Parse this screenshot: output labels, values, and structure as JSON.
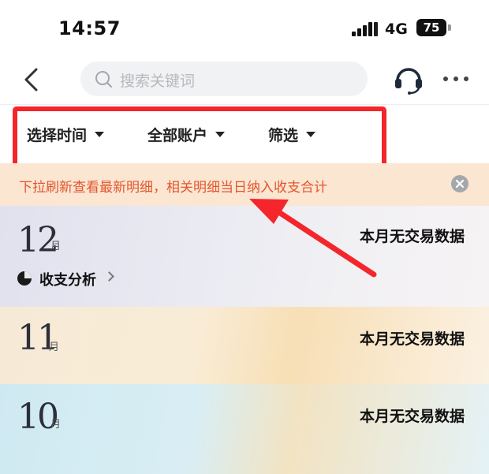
{
  "status": {
    "time": "14:57",
    "network": "4G",
    "battery": "75"
  },
  "nav": {
    "search_placeholder": "搜索关键词"
  },
  "filters": {
    "time": "选择时间",
    "accounts": "全部账户",
    "filter": "筛选"
  },
  "notice": {
    "text": "下拉刷新查看最新明细，相关明细当日纳入收支合计"
  },
  "months": [
    {
      "number": "12",
      "unit": "月",
      "status": "本月无交易数据",
      "analysis": "收支分析"
    },
    {
      "number": "11",
      "unit": "月",
      "status": "本月无交易数据"
    },
    {
      "number": "10",
      "unit": "月",
      "status": "本月无交易数据"
    }
  ],
  "colors": {
    "highlight": "#f4262b",
    "notice_text": "#e2562d",
    "notice_bg": "#fbe6d2"
  },
  "icons": [
    "signal-icon",
    "battery-icon",
    "back-icon",
    "search-icon",
    "headset-icon",
    "more-icon",
    "dropdown-icon",
    "close-icon",
    "pie-chart-icon",
    "chevron-right-icon",
    "annotation-arrow"
  ]
}
